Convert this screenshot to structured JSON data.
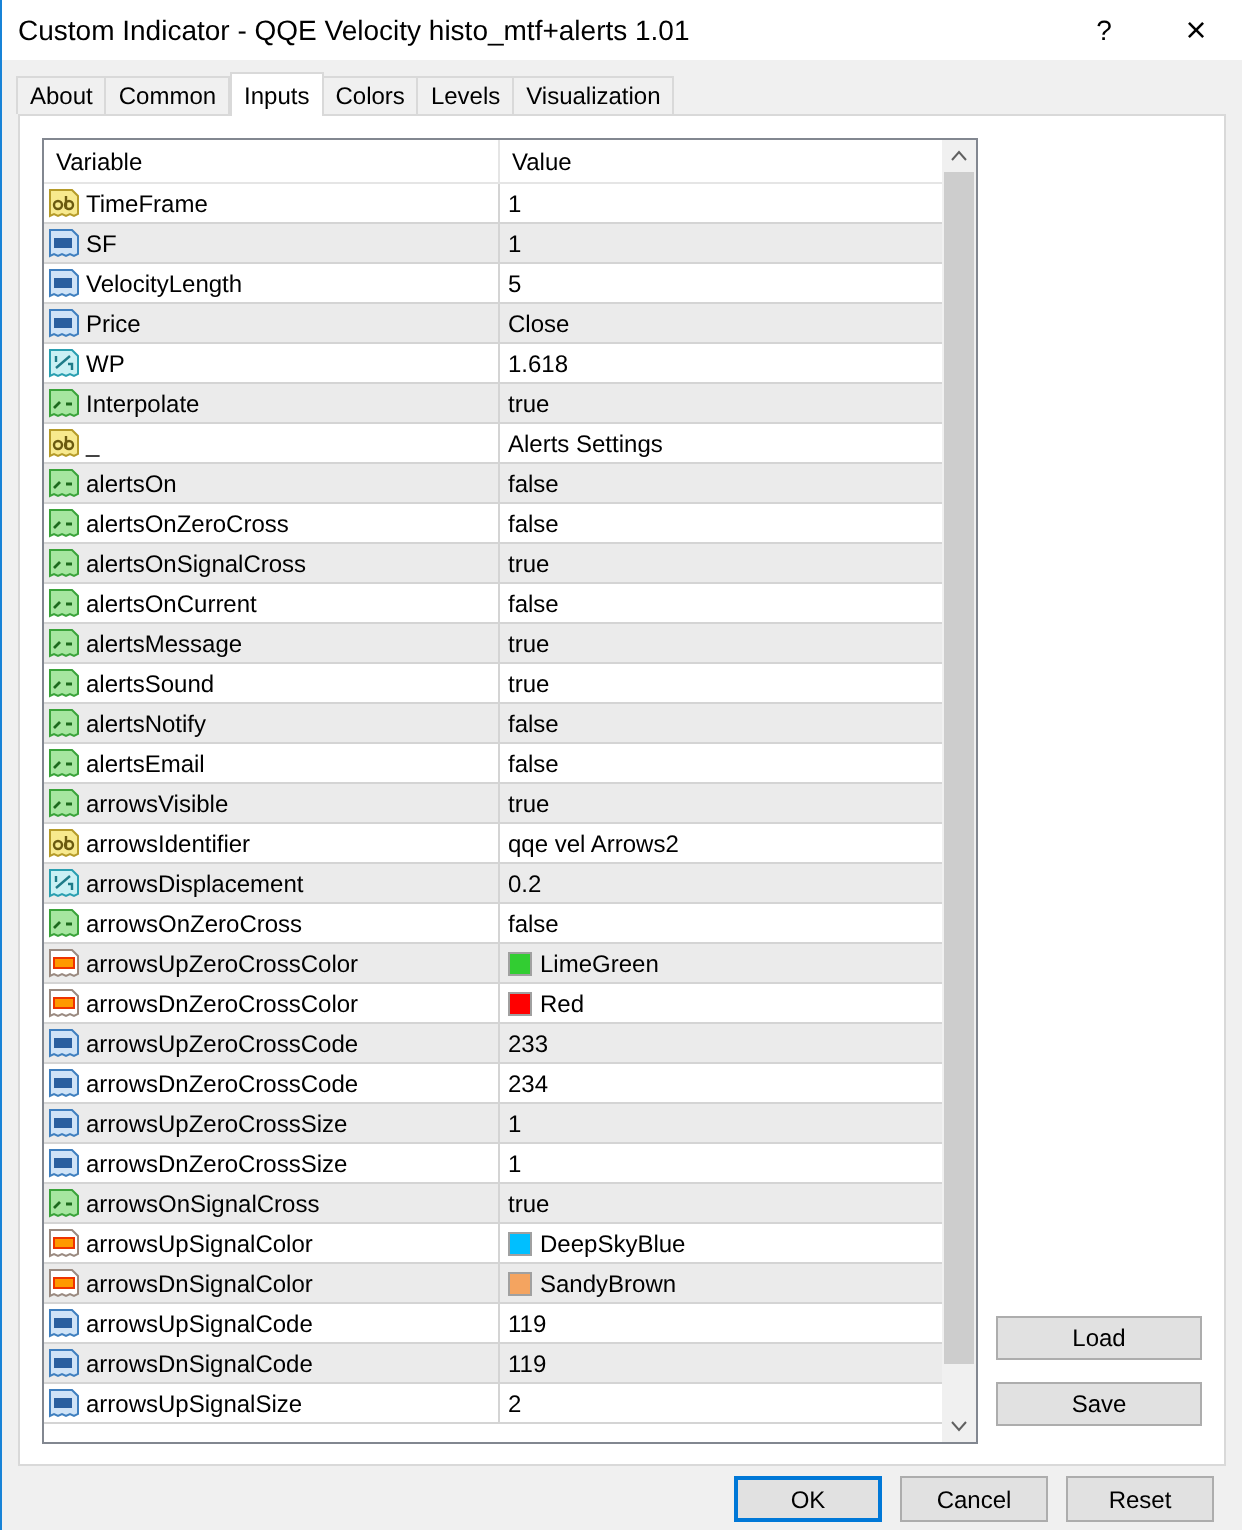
{
  "window": {
    "title": "Custom Indicator - QQE Velocity histo_mtf+alerts 1.01",
    "help": "?",
    "close": "×"
  },
  "tabs": [
    {
      "label": "About",
      "selected": false
    },
    {
      "label": "Common",
      "selected": false
    },
    {
      "label": "Inputs",
      "selected": true
    },
    {
      "label": "Colors",
      "selected": false
    },
    {
      "label": "Levels",
      "selected": false
    },
    {
      "label": "Visualization",
      "selected": false
    }
  ],
  "table": {
    "columns": [
      "Variable",
      "Value"
    ],
    "rows": [
      {
        "kind": "string",
        "name": "TimeFrame",
        "value": "1"
      },
      {
        "kind": "int",
        "name": "SF",
        "value": "1"
      },
      {
        "kind": "int",
        "name": "VelocityLength",
        "value": "5"
      },
      {
        "kind": "int",
        "name": "Price",
        "value": "Close"
      },
      {
        "kind": "double",
        "name": "WP",
        "value": "1.618"
      },
      {
        "kind": "bool",
        "name": "Interpolate",
        "value": "true"
      },
      {
        "kind": "string",
        "name": "_",
        "value": "Alerts Settings"
      },
      {
        "kind": "bool",
        "name": "alertsOn",
        "value": "false"
      },
      {
        "kind": "bool",
        "name": "alertsOnZeroCross",
        "value": "false"
      },
      {
        "kind": "bool",
        "name": "alertsOnSignalCross",
        "value": "true"
      },
      {
        "kind": "bool",
        "name": "alertsOnCurrent",
        "value": "false"
      },
      {
        "kind": "bool",
        "name": "alertsMessage",
        "value": "true"
      },
      {
        "kind": "bool",
        "name": "alertsSound",
        "value": "true"
      },
      {
        "kind": "bool",
        "name": "alertsNotify",
        "value": "false"
      },
      {
        "kind": "bool",
        "name": "alertsEmail",
        "value": "false"
      },
      {
        "kind": "bool",
        "name": "arrowsVisible",
        "value": "true"
      },
      {
        "kind": "string",
        "name": "arrowsIdentifier",
        "value": "qqe vel Arrows2"
      },
      {
        "kind": "double",
        "name": "arrowsDisplacement",
        "value": "0.2"
      },
      {
        "kind": "bool",
        "name": "arrowsOnZeroCross",
        "value": "false"
      },
      {
        "kind": "color",
        "name": "arrowsUpZeroCrossColor",
        "value": "LimeGreen",
        "color": "#32cd32"
      },
      {
        "kind": "color",
        "name": "arrowsDnZeroCrossColor",
        "value": "Red",
        "color": "#ff0000"
      },
      {
        "kind": "int",
        "name": "arrowsUpZeroCrossCode",
        "value": "233"
      },
      {
        "kind": "int",
        "name": "arrowsDnZeroCrossCode",
        "value": "234"
      },
      {
        "kind": "int",
        "name": "arrowsUpZeroCrossSize",
        "value": "1"
      },
      {
        "kind": "int",
        "name": "arrowsDnZeroCrossSize",
        "value": "1"
      },
      {
        "kind": "bool",
        "name": "arrowsOnSignalCross",
        "value": "true"
      },
      {
        "kind": "color",
        "name": "arrowsUpSignalColor",
        "value": "DeepSkyBlue",
        "color": "#00bfff"
      },
      {
        "kind": "color",
        "name": "arrowsDnSignalColor",
        "value": "SandyBrown",
        "color": "#f4a460"
      },
      {
        "kind": "int",
        "name": "arrowsUpSignalCode",
        "value": "119"
      },
      {
        "kind": "int",
        "name": "arrowsDnSignalCode",
        "value": "119"
      },
      {
        "kind": "int",
        "name": "arrowsUpSignalSize",
        "value": "2"
      }
    ]
  },
  "side_buttons": [
    "Load",
    "Save"
  ],
  "buttons": [
    {
      "label": "OK",
      "selected": true
    },
    {
      "label": "Cancel",
      "selected": false
    },
    {
      "label": "Reset",
      "selected": false
    }
  ]
}
